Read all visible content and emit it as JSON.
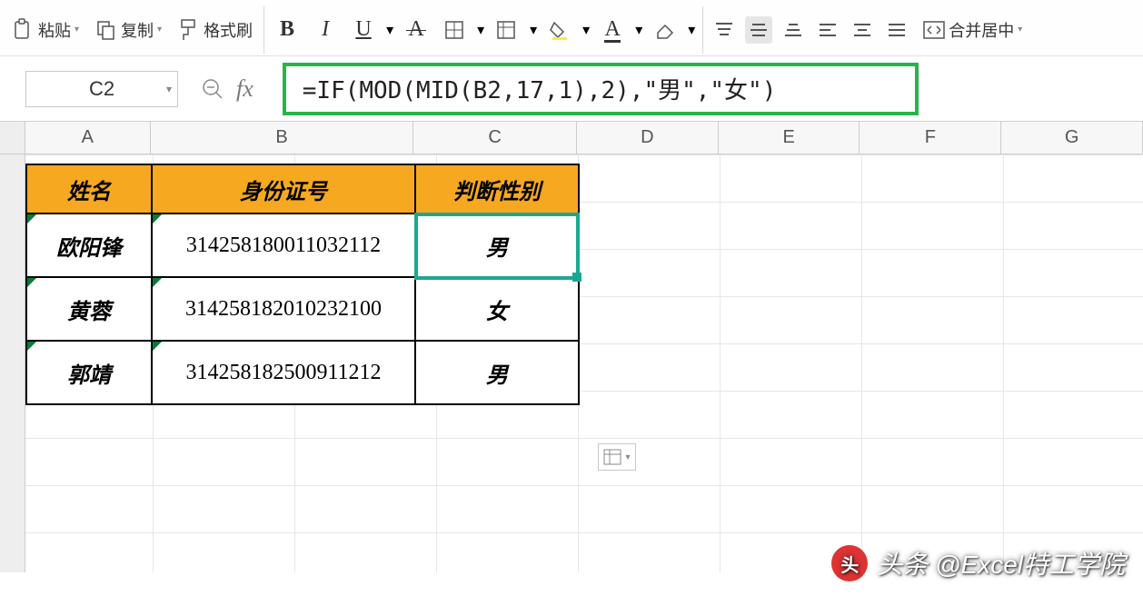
{
  "ribbon": {
    "paste_label": "粘贴",
    "copy_label": "复制",
    "format_painter_label": "格式刷",
    "bold": "B",
    "italic": "I",
    "underline": "U",
    "merge_center_label": "合并居中"
  },
  "name_box": {
    "value": "C2"
  },
  "formula_bar": {
    "fx": "fx",
    "value": "=IF(MOD(MID(B2,17,1),2),\"男\",\"女\")"
  },
  "col_headers": [
    "A",
    "B",
    "C",
    "D",
    "E",
    "F",
    "G"
  ],
  "table": {
    "headers": {
      "A": "姓名",
      "B": "身份证号",
      "C": "判断性别"
    },
    "rows": [
      {
        "A": "欧阳锋",
        "B": "314258180011032112",
        "C": "男"
      },
      {
        "A": "黄蓉",
        "B": "314258182010232100",
        "C": "女"
      },
      {
        "A": "郭靖",
        "B": "314258182500911212",
        "C": "男"
      }
    ]
  },
  "colors": {
    "highlight_border": "#28b34a",
    "selection": "#1aa890",
    "header_fill": "#f6a821"
  },
  "watermark": "头条 @Excel特工学院"
}
